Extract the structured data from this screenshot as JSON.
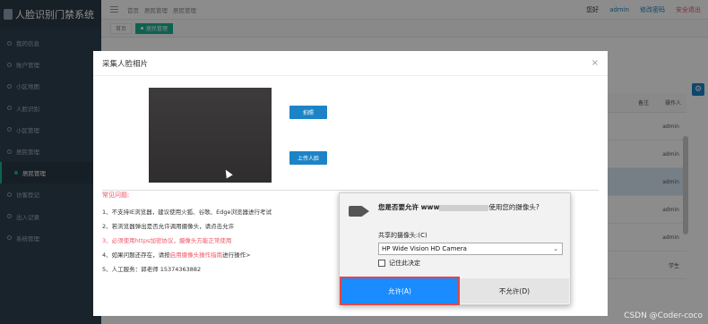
{
  "app": {
    "title": "人脸识别门禁系统"
  },
  "sidebar": {
    "items": [
      {
        "label": "我的信息"
      },
      {
        "label": "账户管理"
      },
      {
        "label": "小区地图"
      },
      {
        "label": "人脸识别"
      },
      {
        "label": "小区管理"
      },
      {
        "label": "居民管理"
      },
      {
        "label": "居民管理"
      },
      {
        "label": "访客登记"
      },
      {
        "label": "出入记录"
      },
      {
        "label": "系统管理"
      }
    ]
  },
  "header": {
    "breadcrumbs": [
      "首页",
      "居民管理",
      "居民管理"
    ],
    "greeting": "您好",
    "username": "admin",
    "change_password": "修改密码",
    "logout": "安全退出"
  },
  "tabs": [
    {
      "label": "首页"
    },
    {
      "label": "居民管理"
    }
  ],
  "table": {
    "headers": [
      "备注",
      "操作人"
    ],
    "rows": [
      {
        "operator": "admin"
      },
      {
        "operator": "admin"
      },
      {
        "operator": "admin"
      },
      {
        "operator": "admin"
      },
      {
        "operator": "admin"
      },
      {
        "operator": "学生"
      }
    ]
  },
  "dialog": {
    "title": "采集人脸相片",
    "close": "×",
    "photo_button": "拍照",
    "upload_button": "上传人脸",
    "faq": {
      "title": "常见问题:",
      "line1": "1、不支持IE浏览器，建议使用火狐、谷歌、Edge浏览器进行考试",
      "line2": "2、若浏览器弹出是否允许调用摄像头，请点击允许",
      "line3": "3、必须使用https加密协议，摄像头方能正常使用",
      "line4_prefix": "4、如果问题还存在，请按",
      "line4_link": "启用摄像头操作指南",
      "line4_suffix": "进行操作>",
      "line5": "5、人工服务：郭老师 15374363882"
    }
  },
  "permission": {
    "question_prefix": "您是否要允许 www",
    "question_suffix": "使用您的摄像头?",
    "shared_camera_label": "共享的摄像头:(C)",
    "camera_option": "HP Wide Vision HD Camera",
    "remember": "记住此决定",
    "allow": "允许(A)",
    "deny": "不允许(D)"
  },
  "watermark": "CSDN @Coder-coco",
  "colors": {
    "sidebar": "#2f4050",
    "accent": "#1ab394",
    "primary": "#1c84c6",
    "danger": "#ed5565",
    "allow": "#1a8cff"
  }
}
